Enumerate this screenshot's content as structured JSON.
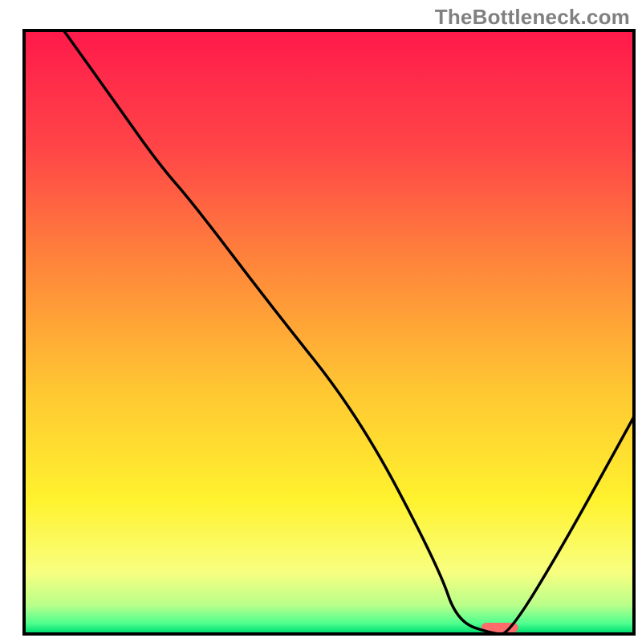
{
  "watermark": "TheBottleneck.com",
  "chart_data": {
    "type": "line",
    "title": "",
    "xlabel": "",
    "ylabel": "",
    "xlim": [
      0,
      100
    ],
    "ylim": [
      0,
      100
    ],
    "grid": false,
    "legend": false,
    "background_gradient": {
      "stops": [
        {
          "offset": 0.0,
          "color": "#ff1a4b"
        },
        {
          "offset": 0.2,
          "color": "#ff4747"
        },
        {
          "offset": 0.4,
          "color": "#ff8a3a"
        },
        {
          "offset": 0.6,
          "color": "#ffc832"
        },
        {
          "offset": 0.78,
          "color": "#fff22e"
        },
        {
          "offset": 0.9,
          "color": "#f8ff80"
        },
        {
          "offset": 0.955,
          "color": "#b8ff8a"
        },
        {
          "offset": 0.985,
          "color": "#4fff8f"
        },
        {
          "offset": 1.0,
          "color": "#00e070"
        }
      ]
    },
    "series": [
      {
        "name": "bottleneck-curve",
        "color": "#000000",
        "x": [
          6.5,
          15,
          22,
          28,
          40,
          55,
          68,
          71,
          77,
          79.5,
          88,
          100
        ],
        "values": [
          100,
          88,
          78,
          71,
          55,
          36,
          11,
          2,
          0,
          0,
          14,
          36
        ]
      }
    ],
    "marker": {
      "name": "optimal-range",
      "x_center": 78,
      "x_width": 6,
      "y": 0,
      "color": "#ff6a6a"
    }
  }
}
